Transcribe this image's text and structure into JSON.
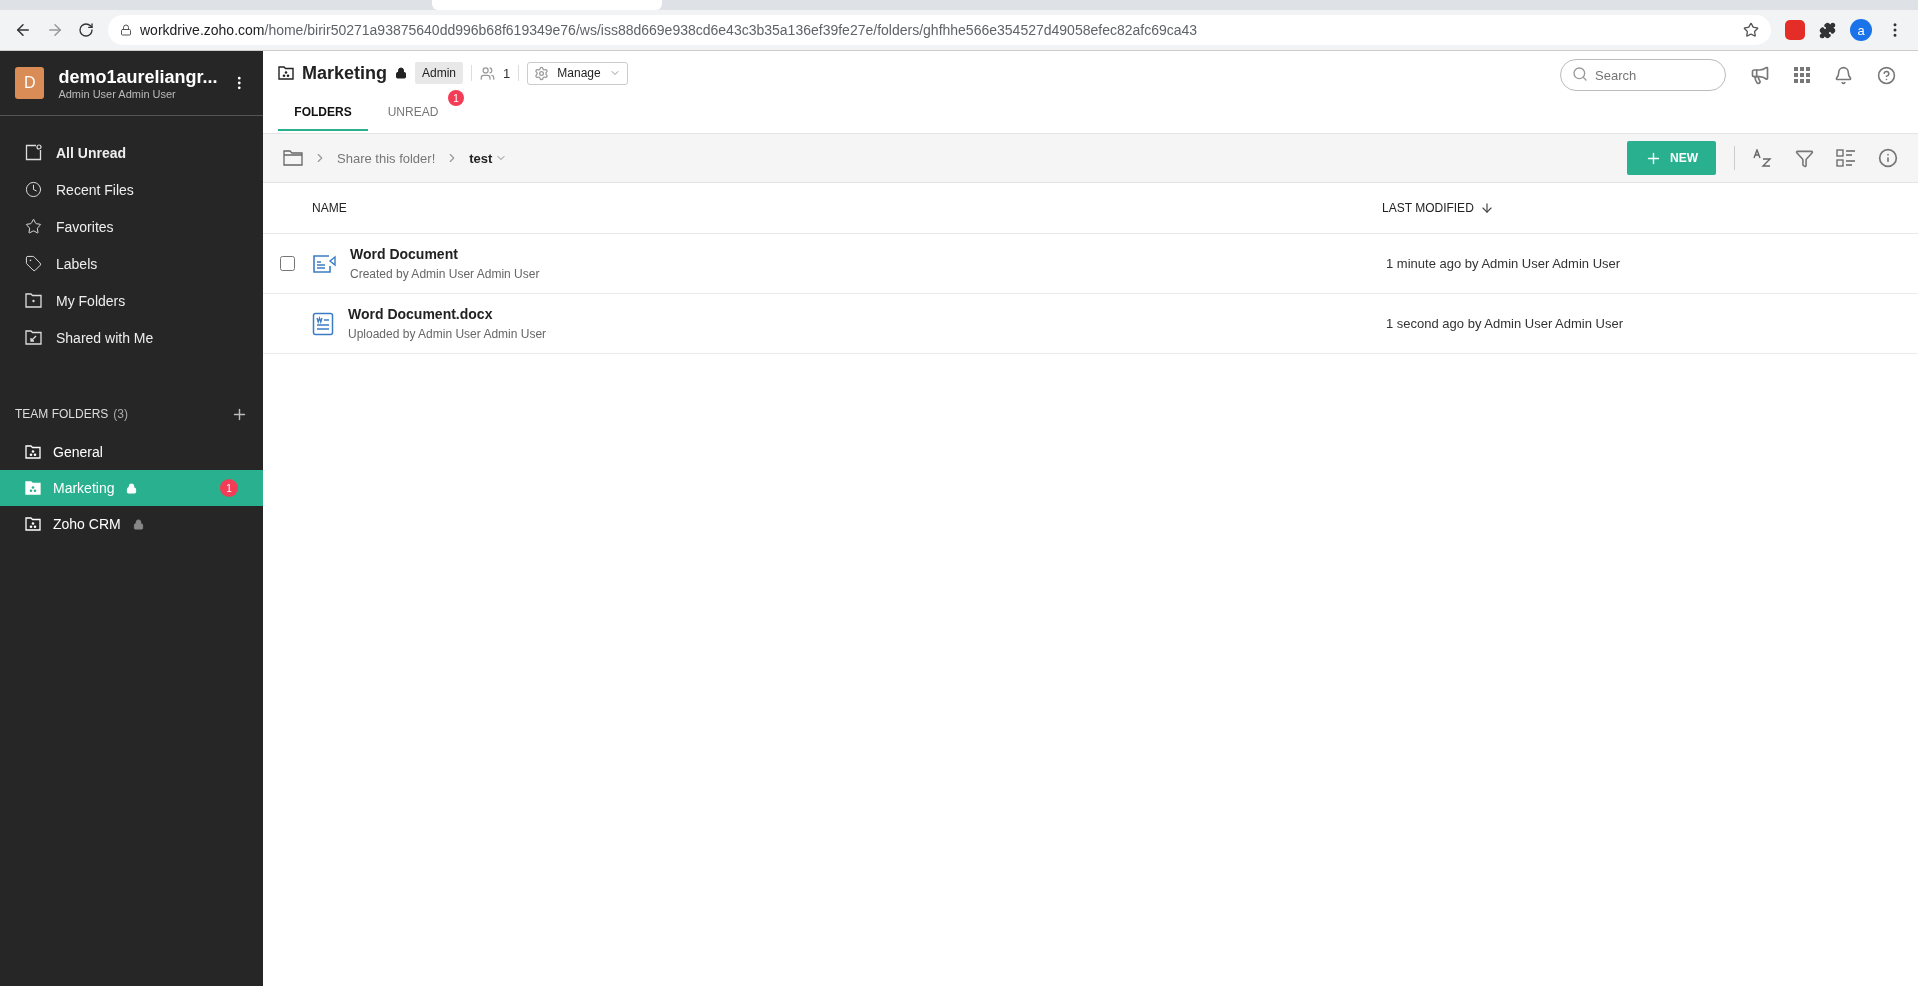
{
  "browser": {
    "url_host": "workdrive.zoho.com",
    "url_path": "/home/birir50271a93875640dd996b68f619349e76/ws/iss88d669e938cd6e43c3b35a136ef39fe27e/folders/ghfhhe566e354527d49058efec82afc69ca43",
    "profile_initial": "a"
  },
  "sidebar": {
    "account": {
      "initial": "D",
      "name": "demo1aureliangr...",
      "subtitle": "Admin User Admin User"
    },
    "nav": [
      {
        "label": "All Unread",
        "kind": "unread"
      },
      {
        "label": "Recent Files",
        "kind": "recent"
      },
      {
        "label": "Favorites",
        "kind": "favorites"
      },
      {
        "label": "Labels",
        "kind": "labels"
      },
      {
        "label": "My Folders",
        "kind": "folders"
      },
      {
        "label": "Shared with Me",
        "kind": "shared"
      }
    ],
    "team_folders": {
      "title": "TEAM FOLDERS",
      "count": "(3)",
      "items": [
        {
          "label": "General",
          "locked": false,
          "selected": false
        },
        {
          "label": "Marketing",
          "locked": true,
          "selected": true,
          "badge": "1"
        },
        {
          "label": "Zoho CRM",
          "locked": true,
          "selected": false
        }
      ]
    }
  },
  "header": {
    "title": "Marketing",
    "locked": true,
    "role": "Admin",
    "members": "1",
    "manage": "Manage",
    "search": {
      "placeholder": "Search"
    },
    "tabs": [
      {
        "label": "FOLDERS",
        "selected": true
      },
      {
        "label": "UNREAD",
        "selected": false,
        "badge": "1"
      }
    ]
  },
  "toolbar": {
    "breadcrumb": [
      "Share this folder!",
      "test"
    ],
    "new_button": "NEW"
  },
  "table": {
    "columns": [
      "NAME",
      "LAST MODIFIED"
    ],
    "rows": [
      {
        "kind": "writer",
        "name": "Word Document",
        "subtitle": "Created by Admin User Admin User",
        "modified": "1 minute ago by Admin User Admin User",
        "hovered": true
      },
      {
        "kind": "docx",
        "name": "Word Document.docx",
        "subtitle": "Uploaded by Admin User Admin User",
        "modified": "1 second ago by Admin User Admin User",
        "hovered": false
      }
    ]
  }
}
